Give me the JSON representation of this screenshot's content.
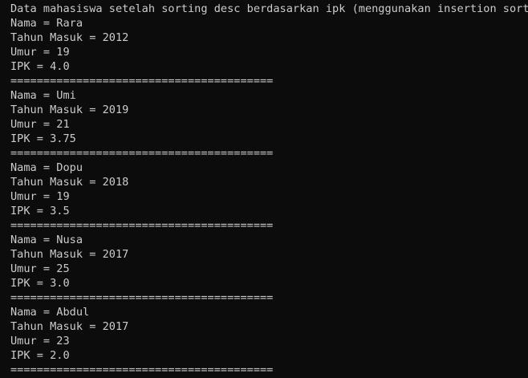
{
  "console": {
    "header": "Data mahasiswa setelah sorting desc berdasarkan ipk (menggunakan insertion sort)",
    "records": [
      {
        "nama": "Nama = Rara",
        "tahun_masuk": "Tahun Masuk = 2012",
        "umur": "Umur = 19",
        "ipk": "IPK = 4.0",
        "separator": "========================================"
      },
      {
        "nama": "Nama = Umi",
        "tahun_masuk": "Tahun Masuk = 2019",
        "umur": "Umur = 21",
        "ipk": "IPK = 3.75",
        "separator": "========================================"
      },
      {
        "nama": "Nama = Dopu",
        "tahun_masuk": "Tahun Masuk = 2018",
        "umur": "Umur = 19",
        "ipk": "IPK = 3.5",
        "separator": "========================================"
      },
      {
        "nama": "Nama = Nusa",
        "tahun_masuk": "Tahun Masuk = 2017",
        "umur": "Umur = 25",
        "ipk": "IPK = 3.0",
        "separator": "========================================"
      },
      {
        "nama": "Nama = Abdul",
        "tahun_masuk": "Tahun Masuk = 2017",
        "umur": "Umur = 23",
        "ipk": "IPK = 2.0",
        "separator": "========================================"
      }
    ],
    "colors": {
      "background": "#0c0c0c",
      "text": "#cccccc"
    }
  }
}
